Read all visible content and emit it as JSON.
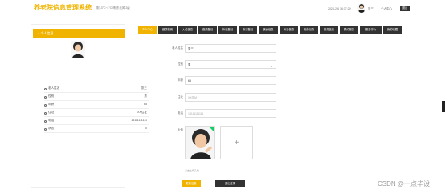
{
  "header": {
    "logo": "养老院信息管理系统",
    "weather": "阴  -3°C~4°C  晴  东北风 2级",
    "datetime": "2024-2-6 16:37:29",
    "user": "张三",
    "personal_center": "个人中心",
    "logout": "退出"
  },
  "side": {
    "title": "个人信息",
    "rows": [
      {
        "label": "老人姓名",
        "value": "张三"
      },
      {
        "label": "性别",
        "value": "男"
      },
      {
        "label": "年龄",
        "value": "65"
      },
      {
        "label": "住址",
        "value": "XX住址"
      },
      {
        "label": "电话",
        "value": "13111111111"
      },
      {
        "label": "状态",
        "value": "0"
      }
    ]
  },
  "tabs": [
    {
      "label": "个人中心",
      "active": true
    },
    {
      "label": "健康档案"
    },
    {
      "label": "入住信息"
    },
    {
      "label": "缴费登记"
    },
    {
      "label": "外出登记"
    },
    {
      "label": "来访登记"
    },
    {
      "label": "膳食信息"
    },
    {
      "label": "每日健康"
    },
    {
      "label": "用药记录"
    },
    {
      "label": "服务信息"
    },
    {
      "label": "预约服务"
    },
    {
      "label": "服务评价"
    },
    {
      "label": "我的收藏"
    }
  ],
  "form": {
    "name_label": "老人姓名",
    "name_value": "张三",
    "gender_label": "性别",
    "gender_value": "男",
    "age_label": "年龄",
    "age_value": "65",
    "address_label": "住址",
    "address_value": "XX住址",
    "phone_label": "电话",
    "phone_value": "13111111111",
    "avatar_label": "头像",
    "upload_plus": "+",
    "upload_tip": "点击上传头像"
  },
  "buttons": {
    "save": "更新信息",
    "logout": "退出登录"
  },
  "watermark": "CSDN @一点毕设"
}
